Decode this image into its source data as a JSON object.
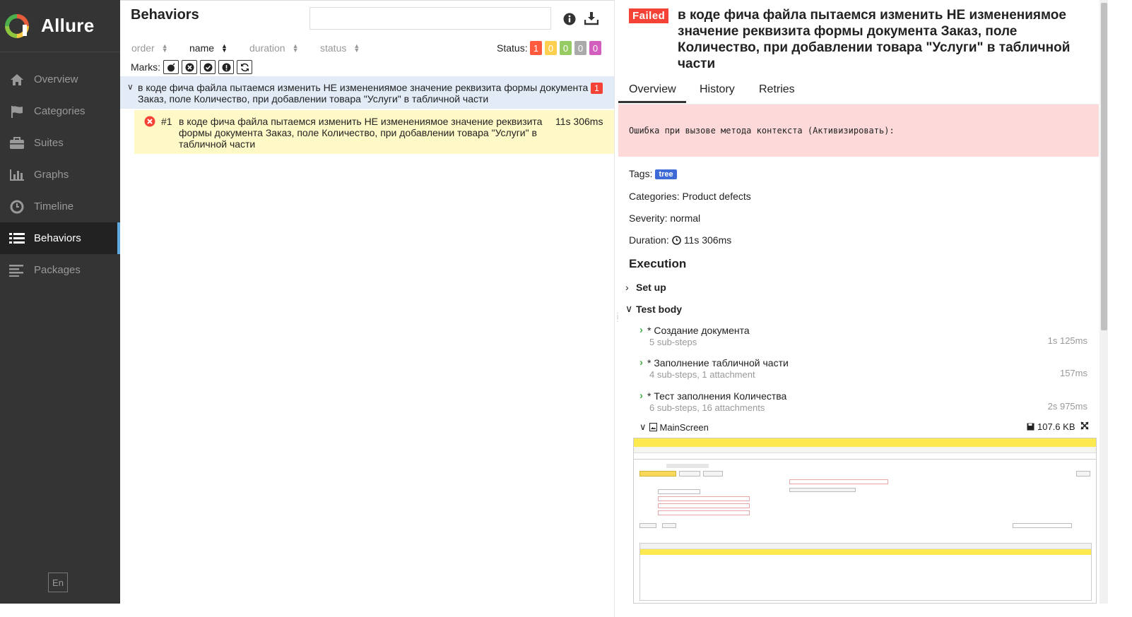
{
  "app": {
    "title": "Allure"
  },
  "sidebar": {
    "items": [
      {
        "label": "Overview",
        "icon": "home-icon"
      },
      {
        "label": "Categories",
        "icon": "flag-icon"
      },
      {
        "label": "Suites",
        "icon": "briefcase-icon"
      },
      {
        "label": "Graphs",
        "icon": "bar-chart-icon"
      },
      {
        "label": "Timeline",
        "icon": "clock-icon"
      },
      {
        "label": "Behaviors",
        "icon": "list-icon",
        "active": true
      },
      {
        "label": "Packages",
        "icon": "align-left-icon"
      }
    ],
    "language": "En"
  },
  "behaviors": {
    "title": "Behaviors",
    "search_placeholder": "",
    "sort": {
      "order": "order",
      "name": "name",
      "duration": "duration",
      "status": "status",
      "active": "name"
    },
    "status_label": "Status:",
    "status_counts": [
      {
        "value": "1",
        "color": "#fd5a3e"
      },
      {
        "value": "0",
        "color": "#ffd050"
      },
      {
        "value": "0",
        "color": "#97cc64"
      },
      {
        "value": "0",
        "color": "#aaaaaa"
      },
      {
        "value": "0",
        "color": "#d35ebe"
      }
    ],
    "marks_label": "Marks:",
    "marks": [
      "bomb-icon",
      "times-circle-icon",
      "check-circle-icon",
      "exclamation-circle-icon",
      "refresh-icon"
    ],
    "group": {
      "text": "в коде фича файла пытаемся изменить НЕ изменениямое значение реквизита формы документа Заказ, поле Количество, при добавлении товара \"Услуги\" в табличной части",
      "count": "1"
    },
    "test_row": {
      "number": "#1",
      "text": "в коде фича файла пытаемся изменить НЕ изменениямое значение реквизита формы документа Заказ, поле Количество, при добавлении товара \"Услуги\" в табличной части",
      "duration": "11s 306ms"
    }
  },
  "test": {
    "status": "Failed",
    "title": "в коде фича файла пытаемся изменить НЕ изменениямое значение реквизита формы документа Заказ, поле Количество, при добавлении товара \"Услуги\" в табличной части",
    "tabs": [
      "Overview",
      "History",
      "Retries"
    ],
    "error_message": "Ошибка при вызове метода контекста (Активизировать):",
    "tags_label": "Tags:",
    "tag": "tree",
    "categories_label": "Categories:",
    "categories": "Product defects",
    "severity_label": "Severity:",
    "severity": "normal",
    "duration_label": "Duration:",
    "duration": "11s 306ms",
    "execution_heading": "Execution",
    "setup_label": "Set up",
    "testbody_label": "Test body",
    "steps": [
      {
        "name": "* Создание документа",
        "sub": "5 sub-steps",
        "duration": "1s 125ms"
      },
      {
        "name": "* Заполнение табличной части",
        "sub": "4 sub-steps, 1 attachment",
        "duration": "157ms"
      },
      {
        "name": "* Тест заполнения Количества",
        "sub": "6 sub-steps, 16 attachments",
        "duration": "2s 975ms"
      }
    ],
    "attachment": {
      "name": "MainScreen",
      "size": "107.6 KB"
    }
  },
  "colors": {
    "failed": "#f44336",
    "sidebar_bg": "#343434",
    "group_bg": "#e3ebf7",
    "row_bg": "#fef9c6",
    "error_bg": "#fdd9d9",
    "tag_bg": "#3e6ad8"
  }
}
